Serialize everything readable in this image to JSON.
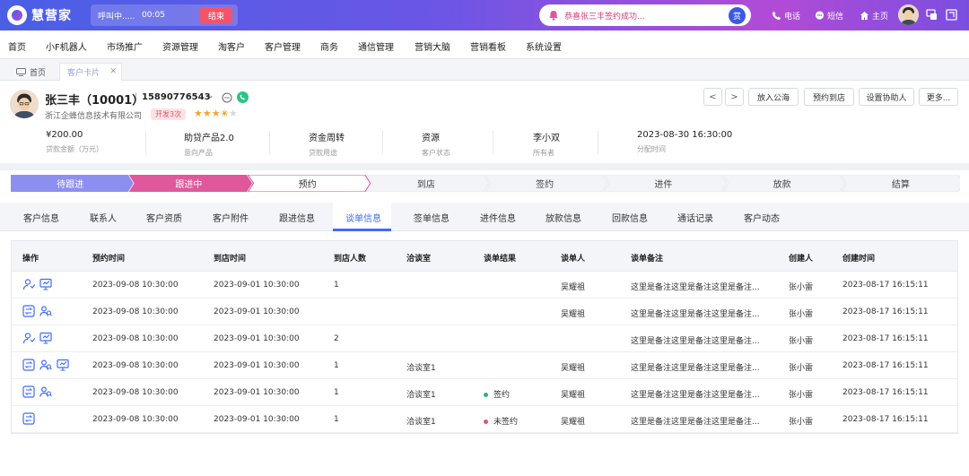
{
  "app": {
    "name": "慧营家"
  },
  "call": {
    "status": "呼叫中.....",
    "timer": "00:05",
    "end_label": "结束"
  },
  "notice": {
    "text": "恭喜张三丰签约成功...",
    "badge": "赏"
  },
  "top_nav": [
    {
      "label": "电话",
      "icon": "phone-icon"
    },
    {
      "label": "短信",
      "icon": "message-icon"
    },
    {
      "label": "主页",
      "icon": "home-icon"
    }
  ],
  "menu": [
    "首页",
    "小F机器人",
    "市场推广",
    "资源管理",
    "淘客户",
    "客户管理",
    "商务",
    "通信管理",
    "营销大脑",
    "营销看板",
    "系统设置"
  ],
  "page_tabs": {
    "home": "首页",
    "active": "客户卡片"
  },
  "customer": {
    "name": "张三丰（10001）",
    "phone": "15890776543",
    "company": "浙江企蜂信息技术有限公司",
    "tag": "开发3次",
    "rating": 3.5,
    "rating_max": 5
  },
  "actions": {
    "prev": "<",
    "next": ">",
    "buttons": [
      "放入公海",
      "预约到店",
      "设置协助人",
      "更多..."
    ]
  },
  "stats": [
    {
      "value": "¥200.00",
      "label": "贷款金额（万元）"
    },
    {
      "value": "助贷产品2.0",
      "label": "意向产品"
    },
    {
      "value": "资金周转",
      "label": "贷款用途"
    },
    {
      "value": "资源",
      "label": "客户状态"
    },
    {
      "value": "李小双",
      "label": "所有者"
    },
    {
      "value": "2023-08-30 16:30:00",
      "label": "分配时间"
    }
  ],
  "stages": [
    {
      "label": "待跟进",
      "state": "done"
    },
    {
      "label": "跟进中",
      "state": "current"
    },
    {
      "label": "预约",
      "state": "next"
    },
    {
      "label": "到店",
      "state": "todo"
    },
    {
      "label": "签约",
      "state": "todo"
    },
    {
      "label": "进件",
      "state": "todo"
    },
    {
      "label": "放款",
      "state": "todo"
    },
    {
      "label": "结算",
      "state": "todo"
    }
  ],
  "sub_tabs": [
    "客户信息",
    "联系人",
    "客户资质",
    "客户附件",
    "跟进信息",
    "谈单信息",
    "签单信息",
    "进件信息",
    "放款信息",
    "回款信息",
    "通话记录",
    "客户动态"
  ],
  "active_sub_tab": "谈单信息",
  "table": {
    "headers": [
      "操作",
      "预约时间",
      "到店时间",
      "到店人数",
      "洽谈室",
      "谈单结果",
      "谈单人",
      "谈单备注",
      "创建人",
      "创建时间"
    ],
    "rows": [
      {
        "ops": [
          "assign-user-icon",
          "presentation-icon"
        ],
        "cells": [
          "2023-09-08 10:30:00",
          "2023-09-01 10:30:00",
          "1",
          "",
          "",
          "吴耀祖",
          "这里是备注这里是备注这里是备注...",
          "张小雷",
          "2023-08-17 16:15:11"
        ]
      },
      {
        "ops": [
          "exchange-icon",
          "users-icon"
        ],
        "cells": [
          "2023-09-08 10:30:00",
          "2023-09-01 10:30:00",
          "",
          "",
          "",
          "吴耀祖",
          "这里是备注这里是备注这里是备注...",
          "张小雷",
          "2023-08-17 16:15:11"
        ]
      },
      {
        "ops": [
          "assign-user-icon",
          "presentation-icon"
        ],
        "cells": [
          "2023-09-08 10:30:00",
          "2023-09-01 10:30:00",
          "2",
          "",
          "",
          "",
          "这里是备注这里是备注这里是备注...",
          "张小雷",
          "2023-08-17 16:15:11"
        ]
      },
      {
        "ops": [
          "exchange-icon",
          "users-icon",
          "presentation-icon"
        ],
        "cells": [
          "2023-09-08 10:30:00",
          "2023-09-01 10:30:00",
          "1",
          "洽谈室1",
          "",
          "吴耀祖",
          "这里是备注这里是备注这里是备注...",
          "张小雷",
          "2023-08-17 16:15:11"
        ]
      },
      {
        "ops": [
          "exchange-icon",
          "users-icon"
        ],
        "cells": [
          "2023-09-08 10:30:00",
          "2023-09-01 10:30:00",
          "1",
          "洽谈室1",
          "签约",
          "吴耀祖",
          "这里是备注这里是备注这里是备注...",
          "张小雷",
          "2023-08-17 16:15:11"
        ]
      },
      {
        "ops": [
          "exchange-icon"
        ],
        "cells": [
          "2023-09-08 10:30:00",
          "2023-09-01 10:30:00",
          "1",
          "洽谈室1",
          "未签约",
          "吴耀祖",
          "这里是备注这里是备注这里是备注...",
          "张小雷",
          "2023-08-17 16:15:11"
        ]
      }
    ]
  },
  "colors": {
    "accent": "#3d6df2",
    "signed": "#2bb673",
    "unsigned": "#e0566d",
    "stage_done": "#8d8ff0",
    "stage_current": "#e0579c"
  }
}
